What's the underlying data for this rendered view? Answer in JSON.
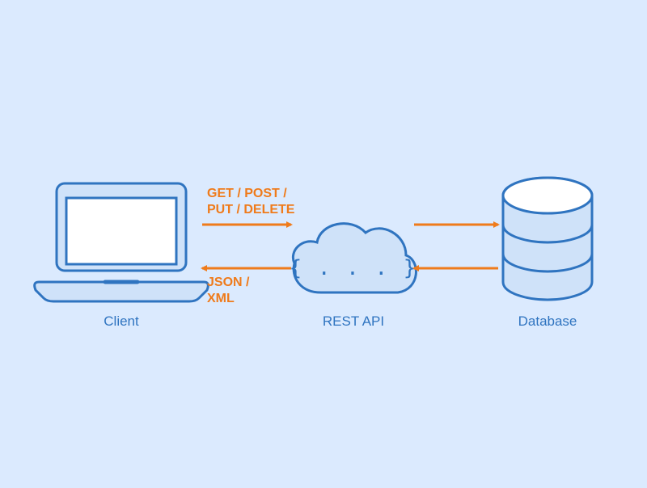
{
  "colors": {
    "bg": "#dbeafe",
    "stroke": "#2f74c0",
    "accent": "#ef7b1b",
    "fillLight": "#cfe2f9",
    "fillWhite": "#ffffff"
  },
  "nodes": {
    "client": {
      "label": "Client",
      "icon": "laptop-icon"
    },
    "api": {
      "label": "REST API",
      "icon": "cloud-icon",
      "inner": "{ . . . }"
    },
    "database": {
      "label": "Database",
      "icon": "database-icon"
    }
  },
  "edges": {
    "client_to_api": {
      "label": "GET / POST /\nPUT / DELETE"
    },
    "api_to_client": {
      "label": "JSON /\nXML"
    },
    "api_to_db": {
      "label": ""
    },
    "db_to_api": {
      "label": ""
    }
  }
}
